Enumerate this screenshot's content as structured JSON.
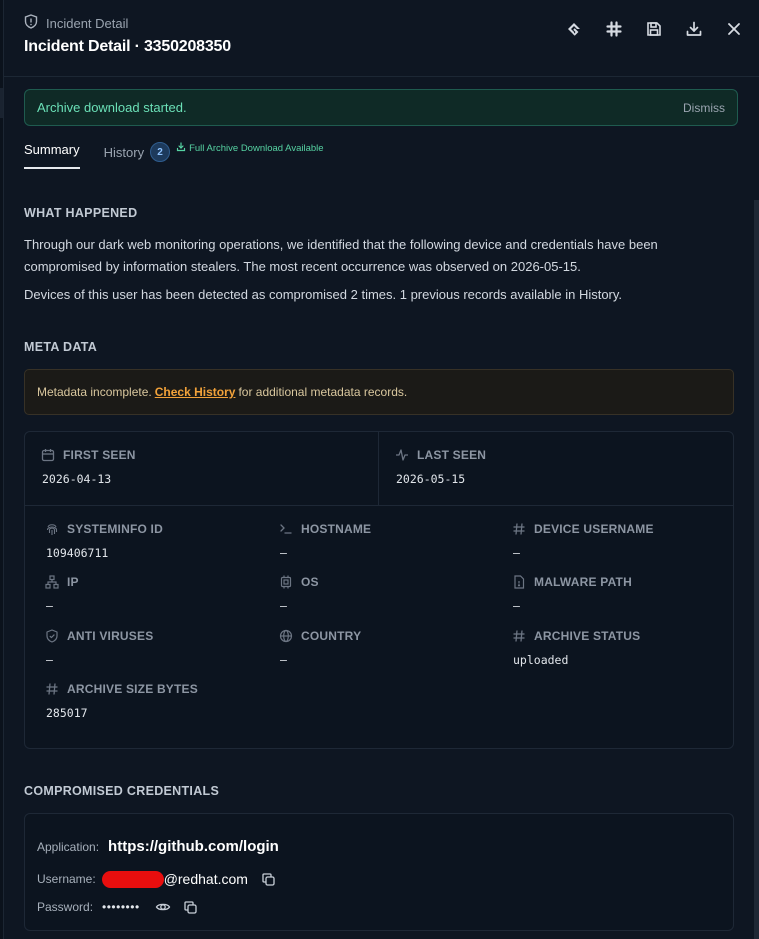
{
  "header": {
    "eyebrow": "Incident Detail",
    "title": "Incident Detail · 3350208350"
  },
  "banner": {
    "message": "Archive download started.",
    "dismiss": "Dismiss"
  },
  "tabs": {
    "summary": "Summary",
    "history": "History",
    "history_count": "2",
    "archive_link": "Full Archive Download Available"
  },
  "what_happened": {
    "heading": "WHAT HAPPENED",
    "line1": "Through our dark web monitoring operations, we identified that the following device and credentials have been",
    "line2": "compromised by information stealers. The most recent occurrence was observed on 2026-05-15.",
    "line3": "Devices of this user has been detected as compromised 2 times. 1 previous records available in History."
  },
  "meta": {
    "heading": "META DATA",
    "warn_prefix": "Metadata incomplete.",
    "warn_link": "Check History",
    "warn_suffix": "for additional metadata records.",
    "first_seen_label": "FIRST SEEN",
    "first_seen": "2026-04-13",
    "last_seen_label": "LAST SEEN",
    "last_seen": "2026-05-15",
    "fields": [
      {
        "label": "SYSTEMINFO ID",
        "value": "109406711",
        "icon": "fingerprint-icon"
      },
      {
        "label": "HOSTNAME",
        "value": "–",
        "icon": "terminal-icon"
      },
      {
        "label": "DEVICE USERNAME",
        "value": "–",
        "icon": "hash-icon"
      },
      {
        "label": "IP",
        "value": "–",
        "icon": "network-icon"
      },
      {
        "label": "OS",
        "value": "–",
        "icon": "cpu-icon"
      },
      {
        "label": "MALWARE PATH",
        "value": "–",
        "icon": "file-icon"
      },
      {
        "label": "ANTI VIRUSES",
        "value": "–",
        "icon": "shield-check-icon"
      },
      {
        "label": "COUNTRY",
        "value": "–",
        "icon": "globe-icon"
      },
      {
        "label": "ARCHIVE STATUS",
        "value": "uploaded",
        "icon": "hash-icon"
      },
      {
        "label": "ARCHIVE SIZE BYTES",
        "value": "285017",
        "icon": "hash-icon"
      }
    ]
  },
  "credentials": {
    "heading": "COMPROMISED CREDENTIALS",
    "application_label": "Application:",
    "application": "https://github.com/login",
    "username_label": "Username:",
    "username_domain": "@redhat.com",
    "password_label": "Password:",
    "password_mask": "••••••••"
  }
}
